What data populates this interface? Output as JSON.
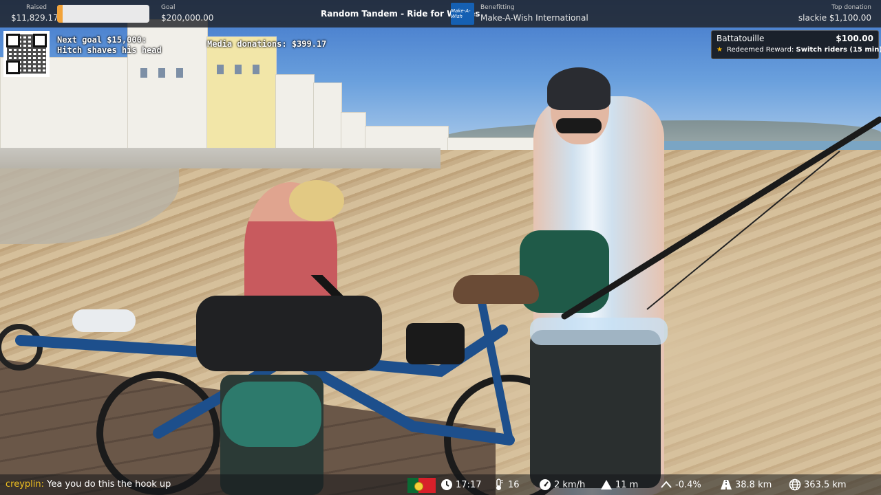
{
  "topbar": {
    "raised_label": "Raised",
    "raised_value": "$11,829.17",
    "raised_progress_fraction": 0.06,
    "goal_label": "Goal",
    "goal_value": "$200,000.00",
    "stream_title": "Random Tandem - Ride for Wishes",
    "charity_logo_text": "Make-A-Wish",
    "benefitting_label": "Benefitting",
    "benefitting_value": "Make-A-Wish International",
    "top_donation_label": "Top donation",
    "top_donation_value": "slackie $1,100.00"
  },
  "overlay": {
    "next_goal_text": "Next goal $15,000: Hitch shaves his head",
    "media_donations_text": "Media donations: $399.17"
  },
  "alert": {
    "user": "Battatouille",
    "amount": "$100.00",
    "star_icon": "star-icon",
    "redeemed_prefix": "Redeemed Reward:",
    "redeemed_reward": "Switch riders (15 min)"
  },
  "chat": {
    "user": "creyplin:",
    "message": "Yea you do this the hook up"
  },
  "status": {
    "flag": "portugal-flag",
    "time": "17:17",
    "temperature": "16",
    "speed": "2 km/h",
    "elevation": "11 m",
    "grade": "-0.4%",
    "trip_distance": "38.8 km",
    "total_distance": "363.5 km"
  },
  "colors": {
    "progress_fill": "#f2a33a",
    "chat_user": "#f0c020",
    "alert_star": "#f5b400"
  }
}
